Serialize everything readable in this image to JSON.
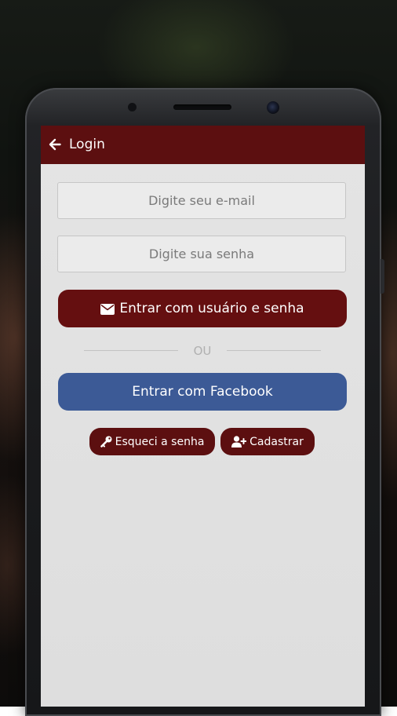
{
  "appbar": {
    "title": "Login",
    "back_icon": "arrow-left-icon",
    "background_color": "#5c0f10"
  },
  "form": {
    "email_placeholder": "Digite seu e-mail",
    "email_value": "",
    "password_placeholder": "Digite sua senha",
    "password_value": ""
  },
  "buttons": {
    "login_label": "Entrar com usuário e senha",
    "login_icon": "envelope-icon",
    "divider_text": "OU",
    "facebook_label": "Entrar com Facebook",
    "forgot_label": "Esqueci a senha",
    "forgot_icon": "key-icon",
    "register_label": "Cadastrar",
    "register_icon": "user-plus-icon"
  },
  "colors": {
    "brand_dark_red": "#650f10",
    "facebook_blue": "#3c5a96",
    "screen_background": "#e4e4e4"
  }
}
